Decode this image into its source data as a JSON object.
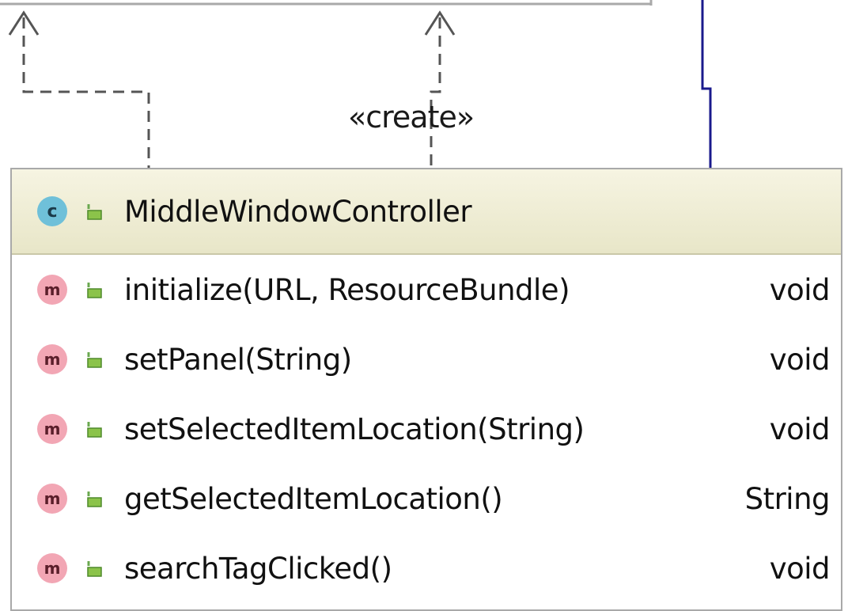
{
  "stereotype": "«create»",
  "class": {
    "kind_icon_letter": "c",
    "name": "MiddleWindowController",
    "kind_icon": "class-icon",
    "visibility_icon": "public-lock-icon",
    "header_color": "#e8e6c8"
  },
  "members": [
    {
      "icon_letter": "m",
      "name": "initialize(URL, ResourceBundle)",
      "type": "void"
    },
    {
      "icon_letter": "m",
      "name": "setPanel(String)",
      "type": "void"
    },
    {
      "icon_letter": "m",
      "name": "setSelectedItemLocation(String)",
      "type": "void"
    },
    {
      "icon_letter": "m",
      "name": "getSelectedItemLocation()",
      "type": "String"
    },
    {
      "icon_letter": "m",
      "name": "searchTagClicked()",
      "type": "void"
    }
  ],
  "colors": {
    "class_icon": "#6fc0d9",
    "method_icon": "#f2a6b4",
    "association_line": "#1a1a8c",
    "dependency_line": "#555555"
  }
}
